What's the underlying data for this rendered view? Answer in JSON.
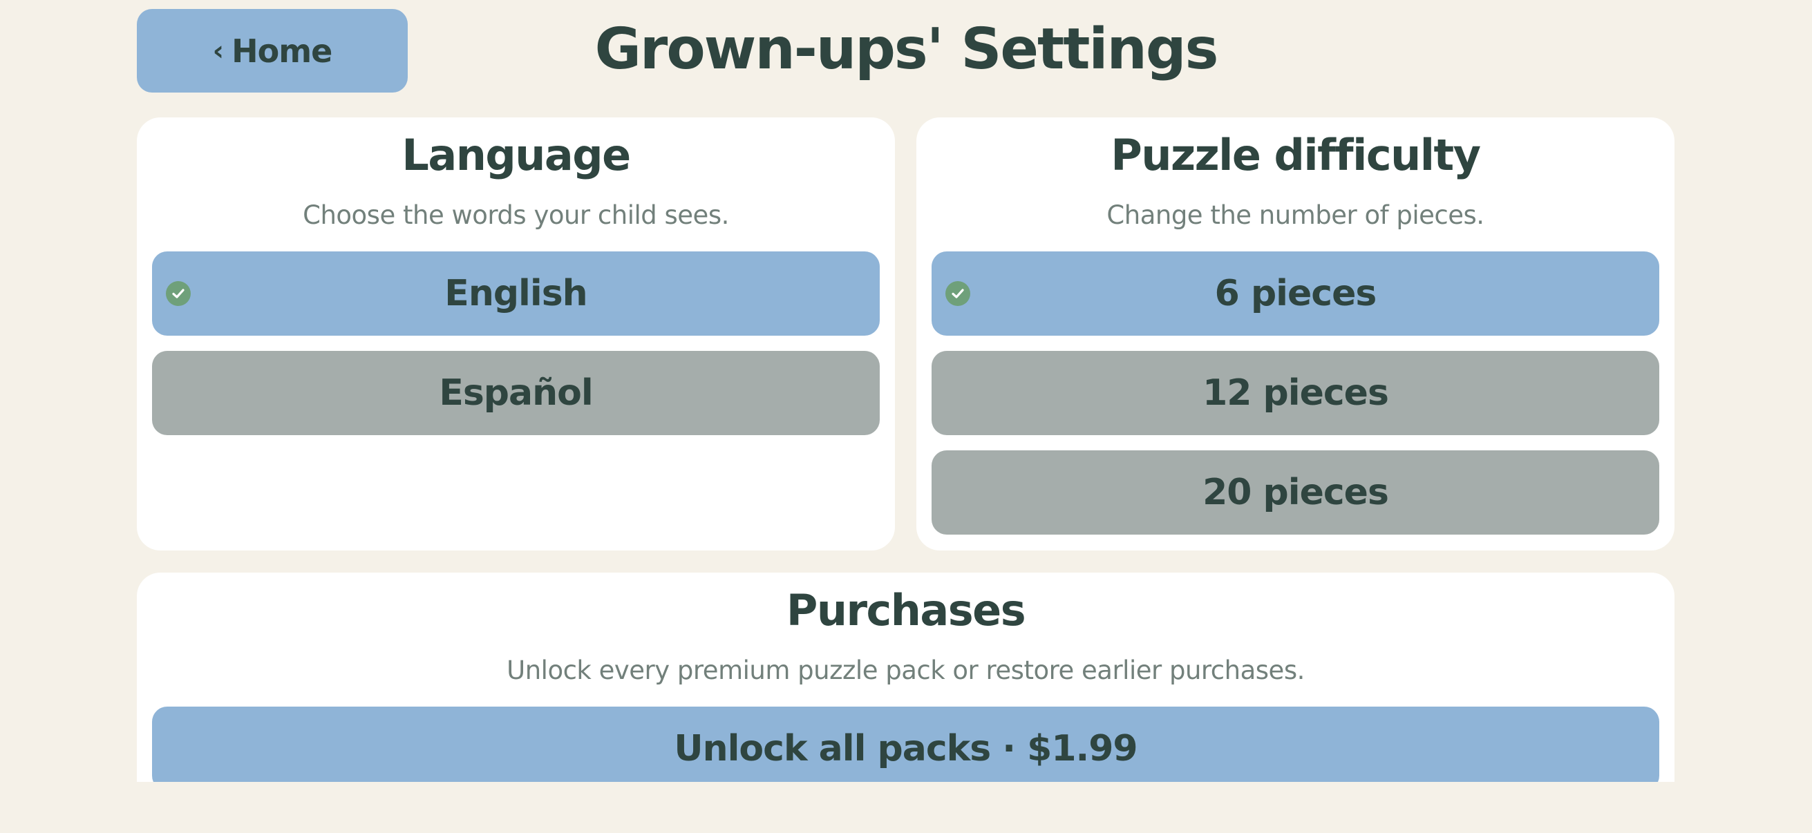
{
  "header": {
    "home_label": "Home",
    "title": "Grown-ups' Settings"
  },
  "language": {
    "title": "Language",
    "subtitle": "Choose the words your child sees.",
    "options": [
      "English",
      "Español"
    ],
    "selected": "English"
  },
  "difficulty": {
    "title": "Puzzle difficulty",
    "subtitle": "Change the number of pieces.",
    "options": [
      "6 pieces",
      "12 pieces",
      "20 pieces"
    ],
    "selected": "6 pieces"
  },
  "purchases": {
    "title": "Purchases",
    "subtitle": "Unlock every premium puzzle pack or restore earlier purchases.",
    "unlock_label": "Unlock all packs · $1.99"
  },
  "colors": {
    "background": "#f5f1e8",
    "card": "#ffffff",
    "selected": "#8fb4d7",
    "unselected": "#a5adab",
    "text": "#2f4540",
    "muted": "#72807b",
    "check": "#6fa07a"
  },
  "icons": {
    "back": "chevron-left-icon",
    "check": "check-circle-icon"
  }
}
